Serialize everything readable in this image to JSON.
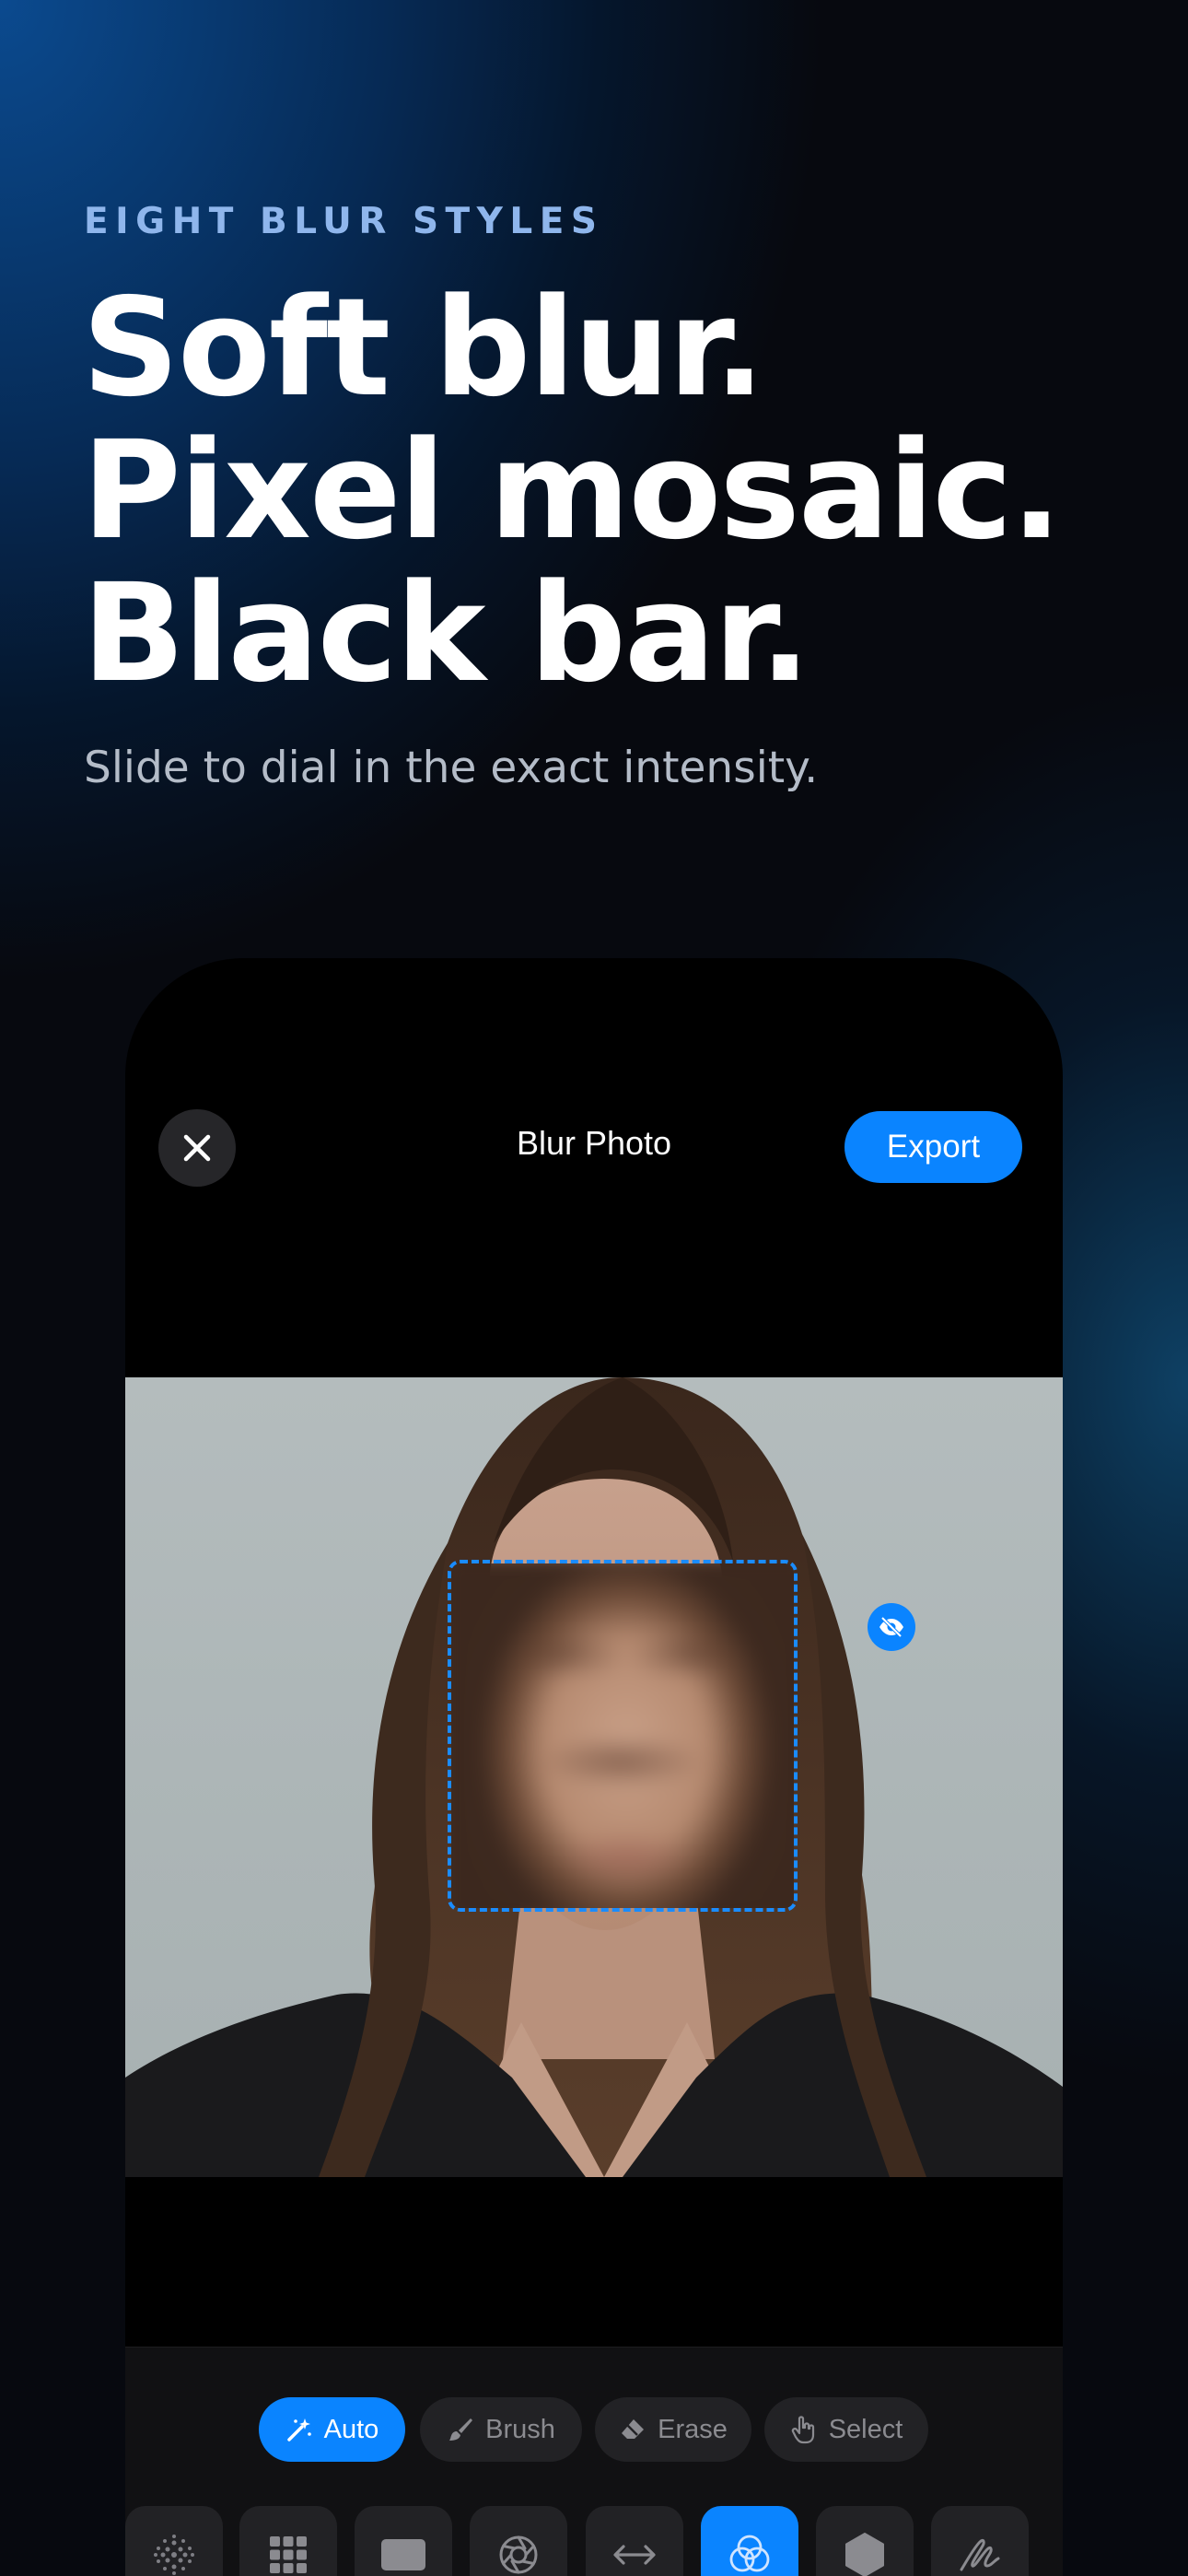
{
  "promo": {
    "eyebrow": "EIGHT BLUR STYLES",
    "headline": [
      "Soft blur.",
      "Pixel mosaic.",
      "Black bar."
    ],
    "subtitle": "Slide to dial in the exact intensity."
  },
  "app": {
    "nav": {
      "close_icon": "close-icon",
      "title": "Blur Photo",
      "export_label": "Export"
    },
    "photo": {
      "selection_badge_icon": "eye-slash-icon"
    },
    "modes": [
      {
        "label": "Auto",
        "icon": "magic-wand-icon",
        "active": true
      },
      {
        "label": "Brush",
        "icon": "brush-icon",
        "active": false
      },
      {
        "label": "Erase",
        "icon": "eraser-icon",
        "active": false
      },
      {
        "label": "Select",
        "icon": "hand-pointer-icon",
        "active": false
      }
    ],
    "styles": [
      {
        "name": "dots-blur",
        "icon": "dots-grid-icon",
        "active": false
      },
      {
        "name": "pixel-mosaic",
        "icon": "pixel-grid-icon",
        "active": false
      },
      {
        "name": "black-bar",
        "icon": "rectangle-icon",
        "active": false
      },
      {
        "name": "aperture",
        "icon": "aperture-icon",
        "active": false
      },
      {
        "name": "stretch",
        "icon": "arrows-horizontal-icon",
        "active": false
      },
      {
        "name": "overlap",
        "icon": "overlapping-circles-icon",
        "active": true
      },
      {
        "name": "hexagon",
        "icon": "hexagon-icon",
        "active": false
      },
      {
        "name": "scribble",
        "icon": "scribble-icon",
        "active": false
      }
    ],
    "colors": {
      "accent": "#0a84ff",
      "toolbar_bg": "#111113",
      "chip_bg": "#222225"
    }
  }
}
